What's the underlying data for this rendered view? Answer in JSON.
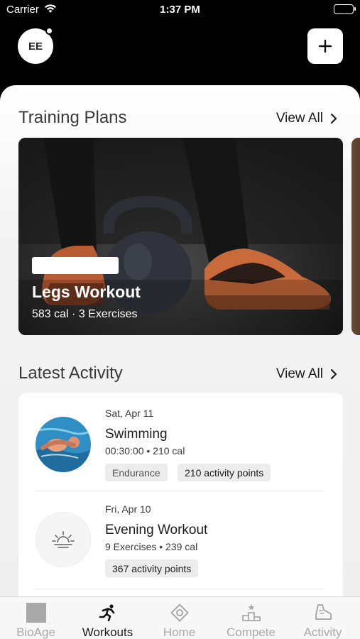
{
  "status_bar": {
    "carrier": "Carrier",
    "time": "1:37 PM"
  },
  "header": {
    "avatar_initials": "EE"
  },
  "training_plans": {
    "title": "Training Plans",
    "view_all": "View All",
    "cards": [
      {
        "title": "Legs Workout",
        "subtitle": "583 cal · 3 Exercises"
      }
    ]
  },
  "latest_activity": {
    "title": "Latest Activity",
    "view_all": "View All",
    "items": [
      {
        "date": "Sat, Apr 11",
        "name": "Swimming",
        "meta": "00:30:00 • 210 cal",
        "chips": [
          "Endurance",
          "210 activity points"
        ]
      },
      {
        "date": "Fri, Apr 10",
        "name": "Evening Workout",
        "meta": "9 Exercises • 239 cal",
        "chips": [
          "367 activity points"
        ]
      }
    ]
  },
  "tab_bar": {
    "tabs": [
      {
        "label": "BioAge",
        "icon": "bioage-icon"
      },
      {
        "label": "Workouts",
        "icon": "running-figure-icon"
      },
      {
        "label": "Home",
        "icon": "home-target-icon"
      },
      {
        "label": "Compete",
        "icon": "podium-icon"
      },
      {
        "label": "Activity",
        "icon": "activity-shoe-icon"
      }
    ],
    "active_tab": "Workouts"
  }
}
